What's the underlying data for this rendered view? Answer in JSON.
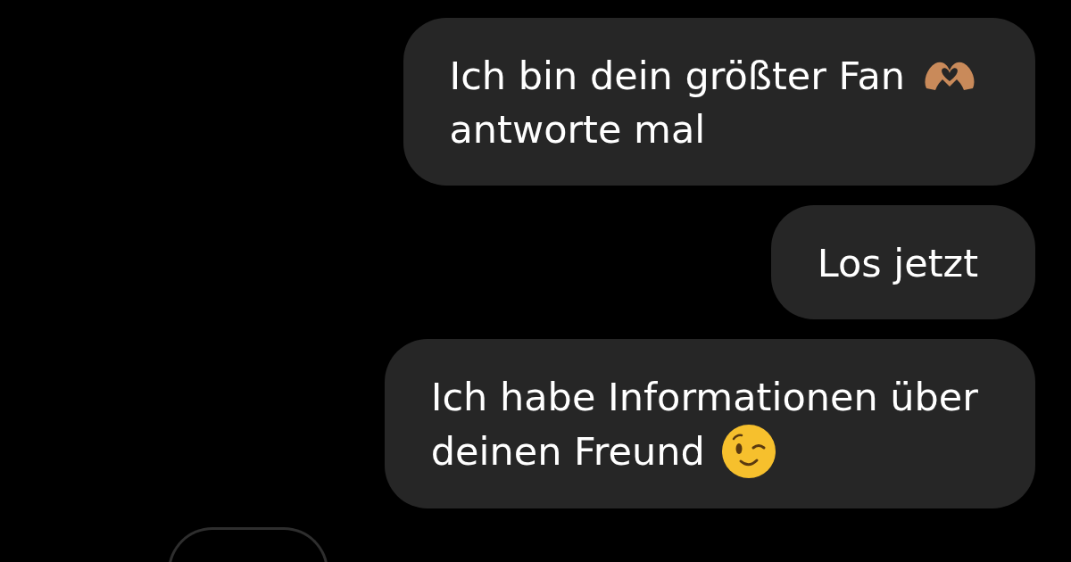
{
  "messages": [
    {
      "lines": [
        {
          "text": "Ich bin dein größter Fan",
          "kind": "heart"
        },
        {
          "text": "antworte mal",
          "kind": "plain"
        }
      ]
    },
    {
      "lines": [
        {
          "text": "Los jetzt",
          "kind": "plain"
        }
      ]
    },
    {
      "lines": [
        {
          "text": "Ich habe Informationen über",
          "kind": "plain"
        },
        {
          "text": "deinen Freund",
          "kind": "wink"
        }
      ]
    }
  ]
}
